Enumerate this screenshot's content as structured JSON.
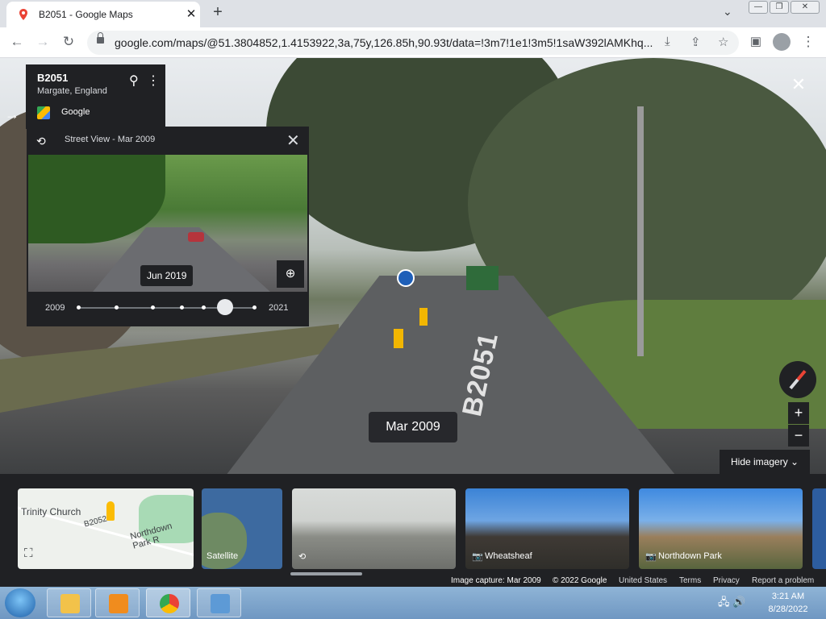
{
  "browser": {
    "tab_title": "B2051 - Google Maps",
    "tab_close": "✕",
    "new_tab": "+",
    "tab_search": "⌄",
    "window_controls": {
      "minimize": "—",
      "restore": "❐",
      "close": "✕"
    },
    "url": "google.com/maps/@51.3804852,1.4153922,3a,75y,126.85h,90.93t/data=!3m7!1e1!3m5!1saW392lAMKhq...",
    "nav": {
      "back": "←",
      "forward": "→",
      "reload": "↻"
    },
    "omnibox_icons": {
      "install": "⤓",
      "share": "⇪",
      "bookmark": "☆"
    },
    "toolbar_icons": {
      "side_panel": "▣",
      "menu": "⋮"
    }
  },
  "street_view": {
    "close": "✕",
    "road_marking": "B2051",
    "date_badge": "Mar 2009",
    "collapse_arrow": "→",
    "info_card": {
      "title": "B2051",
      "subtitle": "Margate, England",
      "source": "Google",
      "pin": "⚲",
      "more": "⋮"
    },
    "time_machine": {
      "history_icon": "⟲",
      "heading": "Street View - Mar 2009",
      "close": "✕",
      "tooltip": "Jun 2019",
      "zoom_icon": "⊕",
      "start_year": "2009",
      "end_year": "2021",
      "slider_position_fraction": 0.83
    },
    "zoom_in": "+",
    "zoom_out": "−",
    "hide_imagery": "Hide imagery ⌄"
  },
  "imagery_strip": {
    "map_card": {
      "place1": "Trinity Church",
      "road": "B2052",
      "road2": "Northdown Park R",
      "expand": "⛶"
    },
    "cards": [
      {
        "label": "Satellite"
      },
      {
        "label": "",
        "icon": "⟲"
      },
      {
        "label": "Wheatsheaf",
        "icon": "📷"
      },
      {
        "label": "Northdown Park",
        "icon": "📷"
      }
    ],
    "footer": {
      "capture": "Image capture: Mar 2009",
      "copyright": "© 2022 Google",
      "region": "United States",
      "terms": "Terms",
      "privacy": "Privacy",
      "report": "Report a problem"
    }
  },
  "taskbar": {
    "clock_time": "3:21 AM",
    "clock_date": "8/28/2022",
    "tray_icons": "🖧 🔊"
  },
  "colors": {
    "accent": "#1a73e8",
    "panel": "#202124",
    "pin": "#ea4335"
  }
}
